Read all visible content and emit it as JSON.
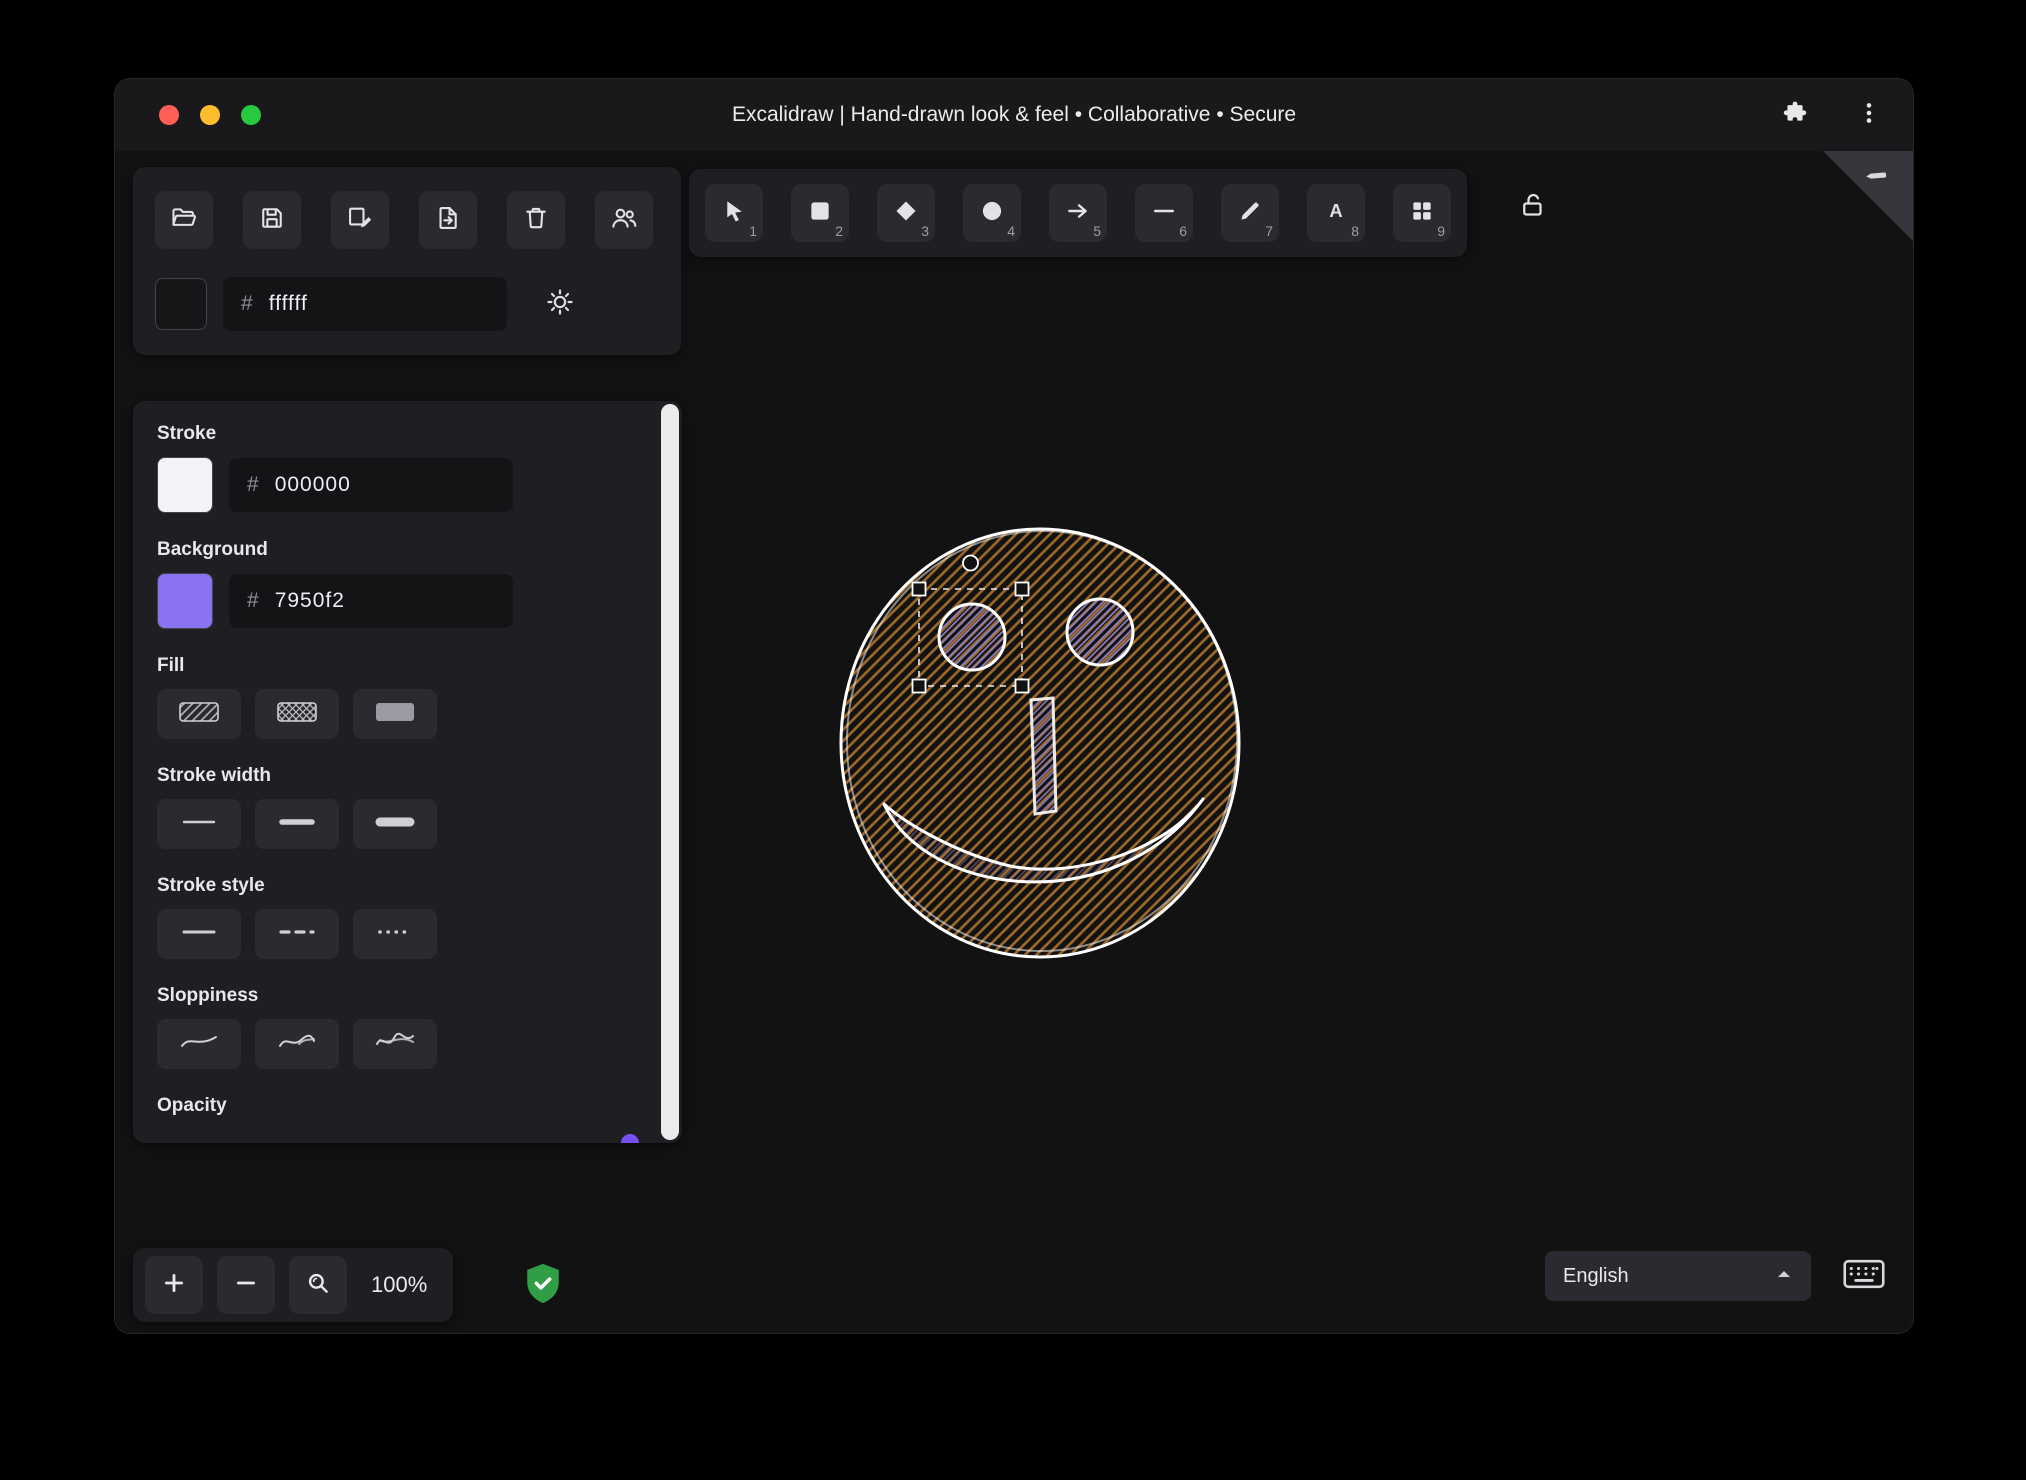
{
  "window": {
    "title": "Excalidraw | Hand-drawn look & feel • Collaborative • Secure"
  },
  "file_toolbar": {
    "open_label": "Open",
    "save_label": "Save",
    "save_as_label": "Save as",
    "export_label": "Export",
    "clear_label": "Clear canvas",
    "collab_label": "Live collaboration",
    "canvas_background": {
      "hash": "#",
      "value": "ffffff",
      "swatch_color": "#17171a"
    }
  },
  "tool_toolbar": {
    "tools": [
      {
        "name": "selection",
        "shortcut": "1"
      },
      {
        "name": "rectangle",
        "shortcut": "2"
      },
      {
        "name": "diamond",
        "shortcut": "3"
      },
      {
        "name": "ellipse",
        "shortcut": "4"
      },
      {
        "name": "arrow",
        "shortcut": "5"
      },
      {
        "name": "line",
        "shortcut": "6"
      },
      {
        "name": "draw",
        "shortcut": "7"
      },
      {
        "name": "text",
        "shortcut": "8"
      },
      {
        "name": "shapes",
        "shortcut": "9"
      }
    ]
  },
  "properties_panel": {
    "stroke": {
      "label": "Stroke",
      "hash": "#",
      "value": "000000",
      "swatch_color": "#f2f2f7"
    },
    "background": {
      "label": "Background",
      "hash": "#",
      "value": "7950f2",
      "swatch_color": "#8b72f2"
    },
    "fill": {
      "label": "Fill"
    },
    "stroke_width": {
      "label": "Stroke width"
    },
    "stroke_style": {
      "label": "Stroke style"
    },
    "sloppiness": {
      "label": "Sloppiness"
    },
    "opacity": {
      "label": "Opacity"
    }
  },
  "canvas": {
    "elements": [
      "face-ellipse",
      "left-eye-ellipse",
      "right-eye-ellipse",
      "nose-rectangle",
      "smile-arc"
    ],
    "selection": "left-eye"
  },
  "footer": {
    "zoom_value": "100%",
    "language_selected": "English"
  },
  "colors": {
    "accent": "#7950f2",
    "canvas_bg": "#121212",
    "island_bg": "#1e1e23",
    "button_bg": "#2a2a30",
    "shield_green": "#2f9e44",
    "face_hachure": "#a06a28",
    "eye_hachure": "#8d7fc4"
  }
}
